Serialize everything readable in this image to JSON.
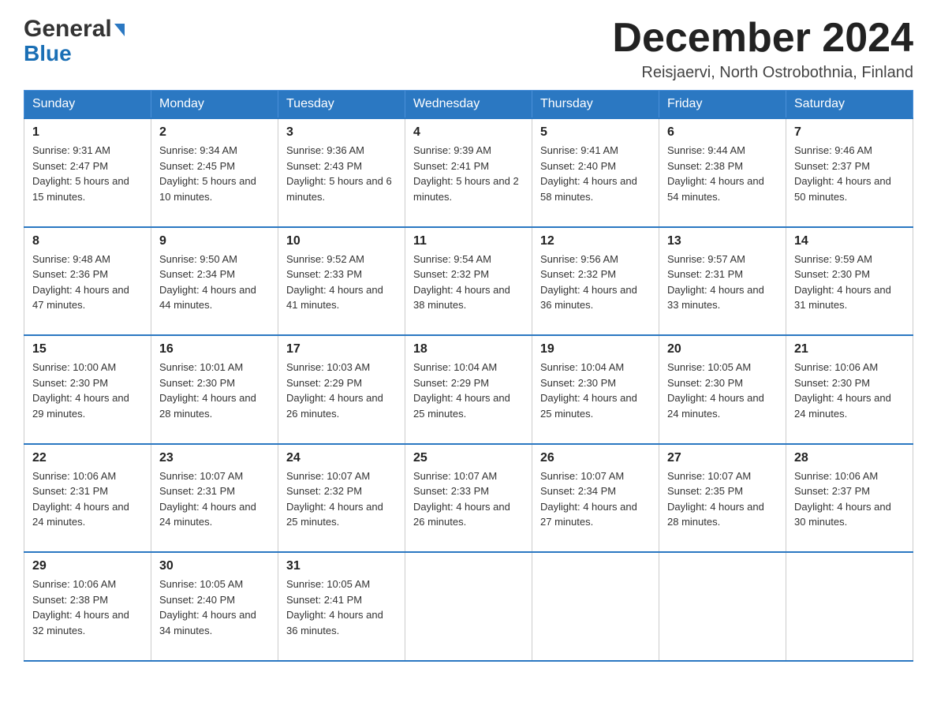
{
  "header": {
    "logo_general": "General",
    "logo_blue": "Blue",
    "month_title": "December 2024",
    "location": "Reisjaervi, North Ostrobothnia, Finland"
  },
  "weekdays": [
    "Sunday",
    "Monday",
    "Tuesday",
    "Wednesday",
    "Thursday",
    "Friday",
    "Saturday"
  ],
  "weeks": [
    [
      {
        "day": "1",
        "sunrise": "9:31 AM",
        "sunset": "2:47 PM",
        "daylight": "5 hours and 15 minutes."
      },
      {
        "day": "2",
        "sunrise": "9:34 AM",
        "sunset": "2:45 PM",
        "daylight": "5 hours and 10 minutes."
      },
      {
        "day": "3",
        "sunrise": "9:36 AM",
        "sunset": "2:43 PM",
        "daylight": "5 hours and 6 minutes."
      },
      {
        "day": "4",
        "sunrise": "9:39 AM",
        "sunset": "2:41 PM",
        "daylight": "5 hours and 2 minutes."
      },
      {
        "day": "5",
        "sunrise": "9:41 AM",
        "sunset": "2:40 PM",
        "daylight": "4 hours and 58 minutes."
      },
      {
        "day": "6",
        "sunrise": "9:44 AM",
        "sunset": "2:38 PM",
        "daylight": "4 hours and 54 minutes."
      },
      {
        "day": "7",
        "sunrise": "9:46 AM",
        "sunset": "2:37 PM",
        "daylight": "4 hours and 50 minutes."
      }
    ],
    [
      {
        "day": "8",
        "sunrise": "9:48 AM",
        "sunset": "2:36 PM",
        "daylight": "4 hours and 47 minutes."
      },
      {
        "day": "9",
        "sunrise": "9:50 AM",
        "sunset": "2:34 PM",
        "daylight": "4 hours and 44 minutes."
      },
      {
        "day": "10",
        "sunrise": "9:52 AM",
        "sunset": "2:33 PM",
        "daylight": "4 hours and 41 minutes."
      },
      {
        "day": "11",
        "sunrise": "9:54 AM",
        "sunset": "2:32 PM",
        "daylight": "4 hours and 38 minutes."
      },
      {
        "day": "12",
        "sunrise": "9:56 AM",
        "sunset": "2:32 PM",
        "daylight": "4 hours and 36 minutes."
      },
      {
        "day": "13",
        "sunrise": "9:57 AM",
        "sunset": "2:31 PM",
        "daylight": "4 hours and 33 minutes."
      },
      {
        "day": "14",
        "sunrise": "9:59 AM",
        "sunset": "2:30 PM",
        "daylight": "4 hours and 31 minutes."
      }
    ],
    [
      {
        "day": "15",
        "sunrise": "10:00 AM",
        "sunset": "2:30 PM",
        "daylight": "4 hours and 29 minutes."
      },
      {
        "day": "16",
        "sunrise": "10:01 AM",
        "sunset": "2:30 PM",
        "daylight": "4 hours and 28 minutes."
      },
      {
        "day": "17",
        "sunrise": "10:03 AM",
        "sunset": "2:29 PM",
        "daylight": "4 hours and 26 minutes."
      },
      {
        "day": "18",
        "sunrise": "10:04 AM",
        "sunset": "2:29 PM",
        "daylight": "4 hours and 25 minutes."
      },
      {
        "day": "19",
        "sunrise": "10:04 AM",
        "sunset": "2:30 PM",
        "daylight": "4 hours and 25 minutes."
      },
      {
        "day": "20",
        "sunrise": "10:05 AM",
        "sunset": "2:30 PM",
        "daylight": "4 hours and 24 minutes."
      },
      {
        "day": "21",
        "sunrise": "10:06 AM",
        "sunset": "2:30 PM",
        "daylight": "4 hours and 24 minutes."
      }
    ],
    [
      {
        "day": "22",
        "sunrise": "10:06 AM",
        "sunset": "2:31 PM",
        "daylight": "4 hours and 24 minutes."
      },
      {
        "day": "23",
        "sunrise": "10:07 AM",
        "sunset": "2:31 PM",
        "daylight": "4 hours and 24 minutes."
      },
      {
        "day": "24",
        "sunrise": "10:07 AM",
        "sunset": "2:32 PM",
        "daylight": "4 hours and 25 minutes."
      },
      {
        "day": "25",
        "sunrise": "10:07 AM",
        "sunset": "2:33 PM",
        "daylight": "4 hours and 26 minutes."
      },
      {
        "day": "26",
        "sunrise": "10:07 AM",
        "sunset": "2:34 PM",
        "daylight": "4 hours and 27 minutes."
      },
      {
        "day": "27",
        "sunrise": "10:07 AM",
        "sunset": "2:35 PM",
        "daylight": "4 hours and 28 minutes."
      },
      {
        "day": "28",
        "sunrise": "10:06 AM",
        "sunset": "2:37 PM",
        "daylight": "4 hours and 30 minutes."
      }
    ],
    [
      {
        "day": "29",
        "sunrise": "10:06 AM",
        "sunset": "2:38 PM",
        "daylight": "4 hours and 32 minutes."
      },
      {
        "day": "30",
        "sunrise": "10:05 AM",
        "sunset": "2:40 PM",
        "daylight": "4 hours and 34 minutes."
      },
      {
        "day": "31",
        "sunrise": "10:05 AM",
        "sunset": "2:41 PM",
        "daylight": "4 hours and 36 minutes."
      },
      null,
      null,
      null,
      null
    ]
  ]
}
